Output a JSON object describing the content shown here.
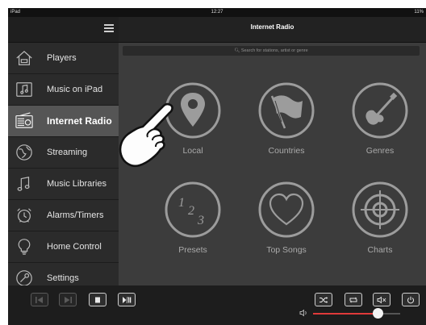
{
  "status_bar": {
    "device": "iPad",
    "time": "12:27",
    "battery": "11%"
  },
  "header": {
    "title": "Internet Radio"
  },
  "search": {
    "placeholder": "Search for stations, artist or genre"
  },
  "sidebar": {
    "items": [
      {
        "label": "Players",
        "icon": "house-icon"
      },
      {
        "label": "Music on iPad",
        "icon": "music-note-icon"
      },
      {
        "label": "Internet Radio",
        "icon": "radio-icon",
        "active": true
      },
      {
        "label": "Streaming",
        "icon": "globe-icon"
      },
      {
        "label": "Music Libraries",
        "icon": "double-note-icon"
      },
      {
        "label": "Alarms/Timers",
        "icon": "alarm-clock-icon"
      },
      {
        "label": "Home Control",
        "icon": "lightbulb-icon"
      },
      {
        "label": "Settings",
        "icon": "wrench-icon"
      }
    ]
  },
  "tiles": [
    {
      "label": "Local",
      "icon": "location-pin-icon"
    },
    {
      "label": "Countries",
      "icon": "flag-icon"
    },
    {
      "label": "Genres",
      "icon": "guitar-icon"
    },
    {
      "label": "Presets",
      "icon": "numbers-123-icon"
    },
    {
      "label": "Top Songs",
      "icon": "heart-icon"
    },
    {
      "label": "Charts",
      "icon": "target-icon"
    }
  ],
  "toolbar": {
    "volume_level": 0.74
  },
  "colors": {
    "accent": "#e03a3a",
    "background": "#3c3c3c",
    "sidebar_active": "#555555"
  }
}
